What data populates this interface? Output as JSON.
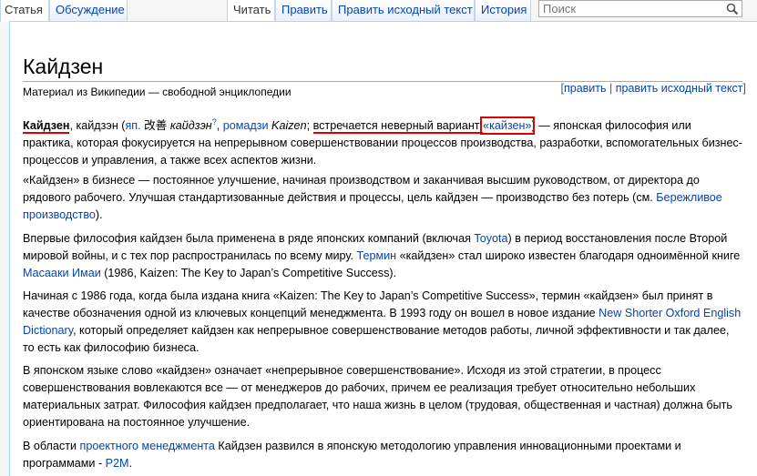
{
  "tabs": {
    "article": "Статья",
    "talk": "Обсуждение",
    "read": "Читать",
    "edit": "Править",
    "edit_source": "Править исходный текст",
    "history": "История"
  },
  "search": {
    "placeholder": "Поиск"
  },
  "page": {
    "title": "Кайдзен",
    "site_sub": "Материал из Википедии — свободной энциклопедии",
    "edit_links": {
      "open": "[",
      "edit": "править",
      "sep": " | ",
      "edit_source": "править исходный текст",
      "close": "]"
    }
  },
  "paragraphs": {
    "p1": {
      "term": "Кайдзен",
      "t1": ", кайдзэн (",
      "lang_link": "яп.",
      "kanji": " 改善 ",
      "reading": "кайдзэн",
      "sup": "?",
      "romaji_link": "ромадзи",
      "romaji": " Kaizen",
      "semi": "; ",
      "note": "встречается неверный вариант ",
      "variant": "«кайзен»",
      "t2": ") — японская философия или практика, которая фокусируется на непрерывном совершенствовании процессов производства, разработки, вспомогательных бизнес-процессов и управления, а также всех аспектов жизни."
    },
    "p2": {
      "t1": "«Кайдзен» в бизнесе — постоянное улучшение, начиная производством и заканчивая высшим руководством, от директора до рядового рабочего. Улучшая стандартизованные действия и процессы, цель кайдзен — производство без потерь (см. ",
      "link": "Бережливое производство",
      "t2": ")."
    },
    "p3": {
      "t1": "Впервые философия кайдзен была применена в ряде японских компаний (включая ",
      "link1": "Toyota",
      "t2": ") в период восстановления после Второй мировой войны, и с тех пор распространилась по всему миру. ",
      "link2": "Термин",
      "t3": " «кайдзен» стал широко известен благодаря одноимённой книге ",
      "link3": "Масааки Имаи",
      "t4": " (1986, Kaizen: The Key to Japan’s Competitive Success)."
    },
    "p4": {
      "t1": "Начиная с 1986 года, когда была издана книга «Kaizen: The Key to Japan’s Competitive Success», термин «кайдзен» был принят в качестве обозначения одной из ключевых концепций менеджмента. В 1993 году он вошел в новое издание ",
      "link": "New Shorter Oxford English Dictionary",
      "t2": ", который определяет кайдзен как непрерывное совершенствование методов работы, личной эффективности и так далее, то есть как философию бизнеса."
    },
    "p5": {
      "t1": "В японском языке слово «кайдзен» означает «непрерывное совершенствование». Исходя из этой стратегии, в процесс совершенствования вовлекаются все — от менеджеров до рабочих, причем ее реализация требует относительно небольших материальных затрат. Философия кайдзен предполагает, что наша жизнь в целом (трудовая, общественная и частная) должна быть ориентирована на постоянное улучшение."
    },
    "p6": {
      "t1": "В области ",
      "link1": "проектного менеджмента",
      "t2": " Кайдзен развился в японскую методологию управления инновационными проектами и программами - ",
      "link2": "P2M",
      "t3": "."
    }
  },
  "colors": {
    "link": "#0645ad",
    "highlight": "#dd0000",
    "border": "#a7d7f9"
  }
}
